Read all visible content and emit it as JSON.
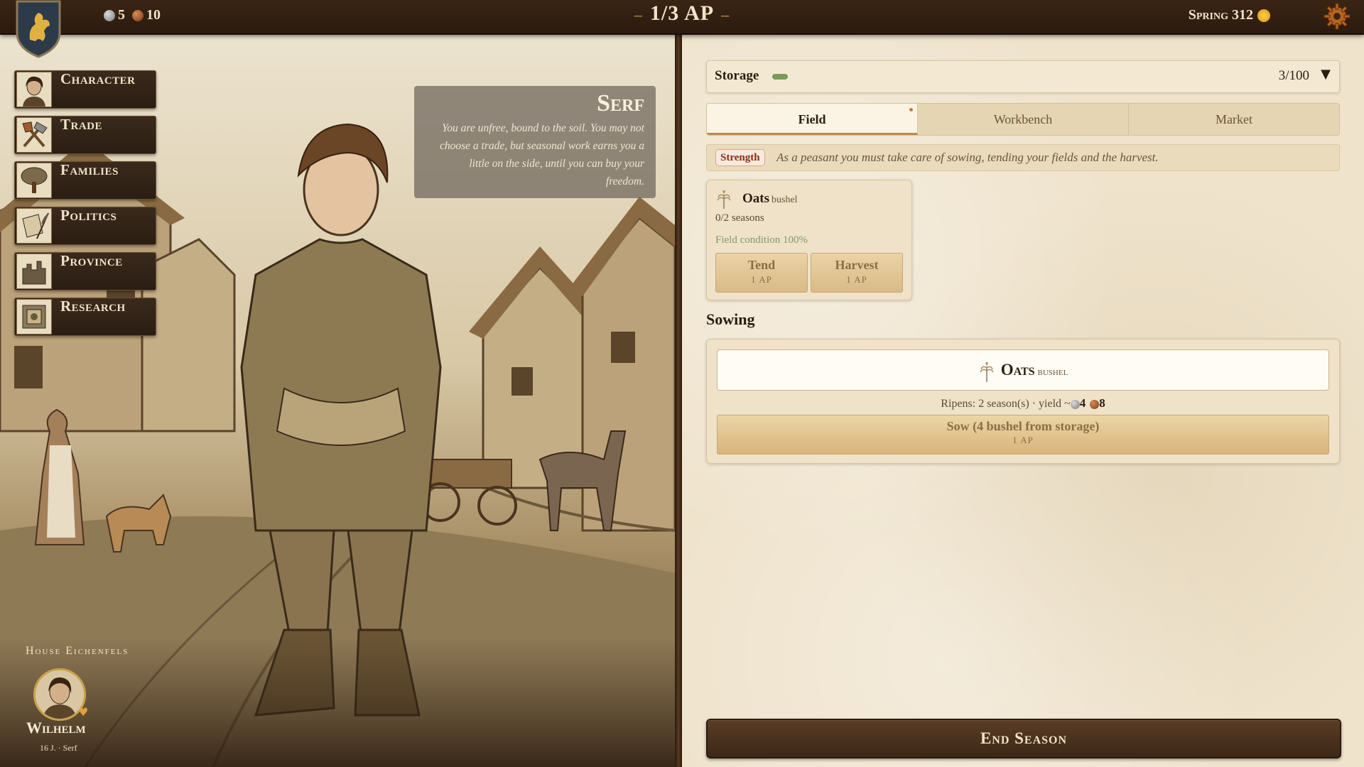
{
  "topbar": {
    "silver": "5",
    "copper": "10",
    "ap": "1/3 AP",
    "season": "Spring 312"
  },
  "menu": {
    "items": [
      {
        "label": "Character"
      },
      {
        "label": "Trade"
      },
      {
        "label": "Families"
      },
      {
        "label": "Politics"
      },
      {
        "label": "Province"
      },
      {
        "label": "Research"
      }
    ]
  },
  "role": {
    "title": "Serf",
    "description": "You are unfree, bound to the soil. You may not choose a trade, but seasonal work earns you a little on the side, until you can buy your freedom."
  },
  "player": {
    "house": "House Eichenfels",
    "name": "Wilhelm",
    "info": "16 J. · Serf"
  },
  "storage": {
    "label": "Storage",
    "count": "3/100",
    "fill_fraction": 0.03
  },
  "tabs": [
    {
      "label": "Field",
      "active": true
    },
    {
      "label": "Workbench",
      "active": false
    },
    {
      "label": "Market",
      "active": false
    }
  ],
  "strength": {
    "badge": "Strength",
    "text": "As a peasant you must take care of sowing, tending your fields and the harvest."
  },
  "crop": {
    "name": "Oats",
    "unit": "bushel",
    "seasons": "0/2 seasons",
    "condition": "Field condition 100%",
    "tend_label": "Tend",
    "tend_cost": "1 AP",
    "harvest_label": "Harvest",
    "harvest_cost": "1 AP"
  },
  "sowing": {
    "title": "Sowing",
    "crop_name": "Oats",
    "crop_unit": "bushel",
    "ripens_text": "Ripens: 2 season(s) · yield ~",
    "yield_silver": "4",
    "yield_copper": "8",
    "sow_label": "Sow (4 bushel from storage)",
    "sow_cost": "1 AP"
  },
  "end_season": "End Season",
  "colors": {
    "accent_gold": "#c9a24a",
    "field_green": "#7e9b64",
    "strength_red": "#8b2e14",
    "dark_wood": "#3c2716"
  }
}
